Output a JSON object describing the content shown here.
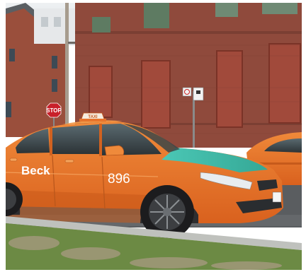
{
  "taxi": {
    "brand": "Beck",
    "fleet_number": "896",
    "roof_sign": "TAXI"
  },
  "street_sign": {
    "stop": "STOP"
  },
  "colors": {
    "taxi_orange": "#e8742c",
    "taxi_teal": "#3fb9a8",
    "brick": "#8f4a3c",
    "grass": "#6c8a44"
  }
}
